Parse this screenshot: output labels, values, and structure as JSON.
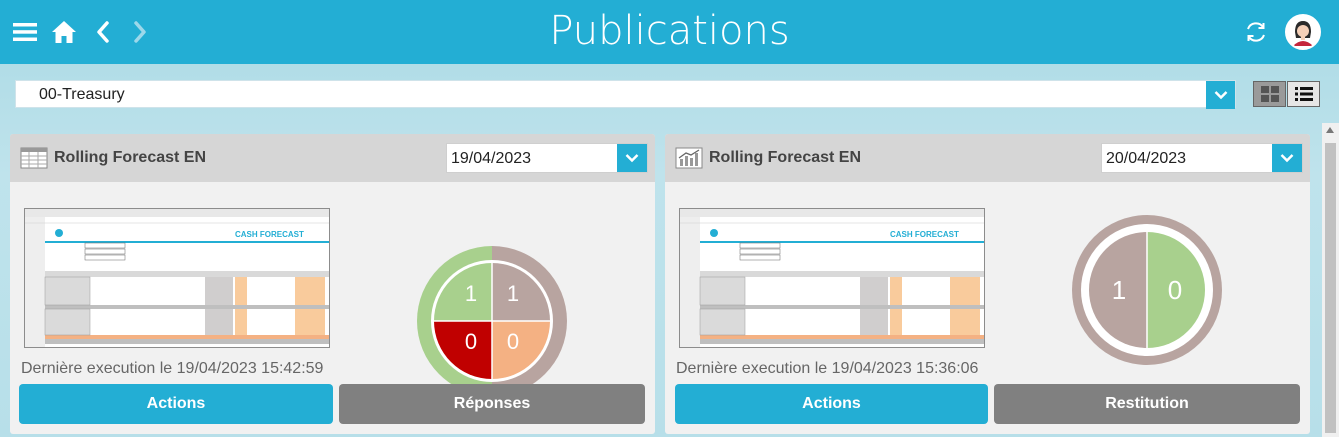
{
  "header": {
    "title": "Publications",
    "icons": [
      "menu-icon",
      "home-icon",
      "back-icon",
      "forward-icon",
      "refresh-icon",
      "user-avatar"
    ]
  },
  "selector": {
    "value": "00-Treasury"
  },
  "view_toggles": [
    "grid-view-icon",
    "list-view-icon"
  ],
  "cards": [
    {
      "title": "Rolling Forecast EN",
      "date": "19/04/2023",
      "icon": "spreadsheet-icon",
      "thumbnail_title": "CASH FORECAST",
      "last_execution": "Dernière execution le 19/04/2023 15:42:59",
      "chart": {
        "type": "pie",
        "segments": [
          {
            "value": "1",
            "color": "#a8d08d"
          },
          {
            "value": "1",
            "color": "#b8a4a0"
          },
          {
            "value": "0",
            "color": "#c00000"
          },
          {
            "value": "0",
            "color": "#f4b183"
          }
        ]
      },
      "buttons": [
        "Actions",
        "Réponses"
      ]
    },
    {
      "title": "Rolling Forecast EN",
      "date": "20/04/2023",
      "icon": "chart-icon",
      "thumbnail_title": "CASH FORECAST",
      "last_execution": "Dernière execution le 19/04/2023 15:36:06",
      "chart": {
        "type": "pie",
        "segments": [
          {
            "value": "1",
            "color": "#b8a4a0"
          },
          {
            "value": "0",
            "color": "#a8d08d"
          }
        ]
      },
      "buttons": [
        "Actions",
        "Restitution"
      ]
    }
  ],
  "colors": {
    "accent": "#23aed4",
    "button_gray": "#808080"
  }
}
